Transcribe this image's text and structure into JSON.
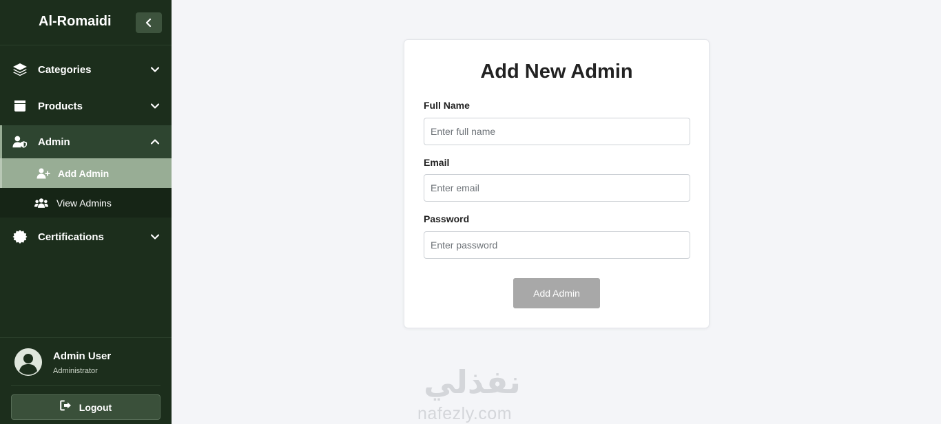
{
  "sidebar": {
    "brand": "Al-Romaidi",
    "items": [
      {
        "label": "Categories",
        "icon": "layers-icon"
      },
      {
        "label": "Products",
        "icon": "box-icon"
      },
      {
        "label": "Admin",
        "icon": "user-shield-icon",
        "expanded": true,
        "children": [
          {
            "label": "Add Admin",
            "icon": "user-plus-icon",
            "active": true
          },
          {
            "label": "View Admins",
            "icon": "users-icon"
          }
        ]
      },
      {
        "label": "Certifications",
        "icon": "certificate-icon"
      }
    ],
    "user": {
      "name": "Admin User",
      "role": "Administrator"
    },
    "logout_label": "Logout"
  },
  "form": {
    "title": "Add New Admin",
    "fields": [
      {
        "label": "Full Name",
        "placeholder": "Enter full name",
        "value": ""
      },
      {
        "label": "Email",
        "placeholder": "Enter email",
        "value": ""
      },
      {
        "label": "Password",
        "placeholder": "Enter password",
        "value": ""
      }
    ],
    "submit_label": "Add Admin"
  },
  "watermark": {
    "arabic": "نفذلي",
    "latin": "nafezly.com"
  },
  "colors": {
    "sidebar_bg": "#1c2e1c",
    "active_item_bg": "#98ad95",
    "page_bg": "#f4f5f8",
    "button_disabled": "#a8a8a8"
  }
}
